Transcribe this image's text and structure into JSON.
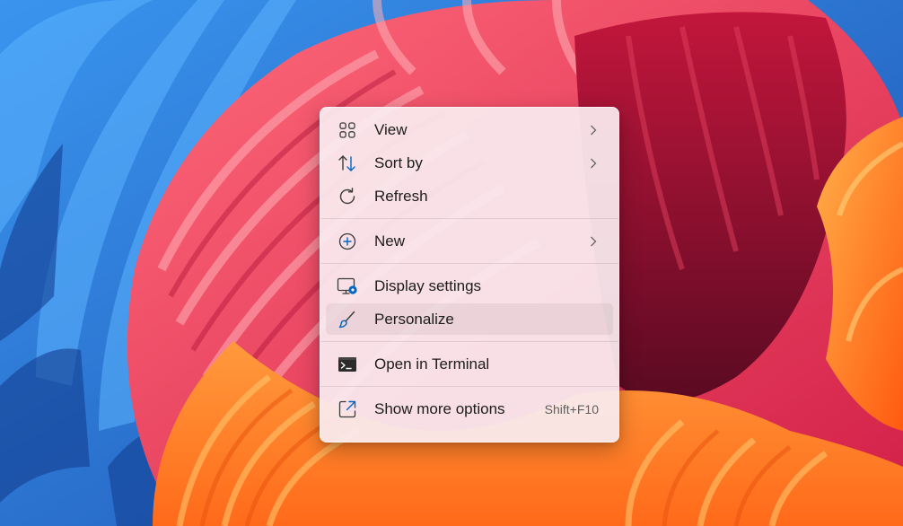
{
  "desktop": {
    "wallpaper_icon": "abstract-flower-wallpaper"
  },
  "context_menu": {
    "items": [
      {
        "label": "View",
        "icon": "grid-icon",
        "has_submenu": true
      },
      {
        "label": "Sort by",
        "icon": "sort-arrows-icon",
        "has_submenu": true
      },
      {
        "label": "Refresh",
        "icon": "refresh-icon",
        "has_submenu": false
      },
      {
        "label": "New",
        "icon": "plus-circle-icon",
        "has_submenu": true
      },
      {
        "label": "Display settings",
        "icon": "display-settings-icon",
        "has_submenu": false
      },
      {
        "label": "Personalize",
        "icon": "paintbrush-icon",
        "has_submenu": false,
        "highlighted": true
      },
      {
        "label": "Open in Terminal",
        "icon": "terminal-icon",
        "has_submenu": false
      },
      {
        "label": "Show more options",
        "icon": "expand-icon",
        "has_submenu": false,
        "shortcut": "Shift+F10"
      }
    ]
  },
  "colors": {
    "menu_background": "#faecf0",
    "accent": "#0067c0",
    "text": "#1c1c1c"
  }
}
